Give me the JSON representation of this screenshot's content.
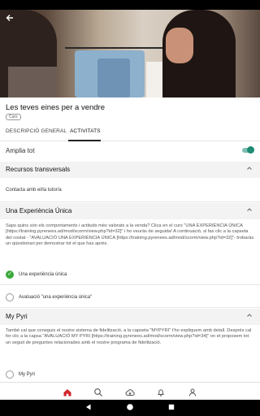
{
  "status_bar": {
    "time": "",
    "icons": ""
  },
  "hero": {
    "back_icon": "back-arrow-icon"
  },
  "course": {
    "title": "Les teves eines per a vendre",
    "chip": "Curs"
  },
  "tabs": [
    {
      "label": "DESCRIPCIÓ GENERAL"
    },
    {
      "label": "ACTIVITATS"
    }
  ],
  "expand_all": {
    "label": "Amplia tot",
    "enabled": true
  },
  "sections": {
    "recursos": {
      "title": "Recursos transversals",
      "item": "Contacta amb el/la tutor/a"
    },
    "experiencia": {
      "title": "Una Experiència Única",
      "description": "Saps quins són els comportaments i actituds més valorats a la venda? Clica en el curs \"UNA EXPERIÈNCIA ÚNICA [https://training.pyrenees.ad/mod/scorm/view.php?id=32]\" i ho veuràs de seguida! A continuació, si fas clic a la capseta del costat - \"AVALUACIÓ UNA EXPERIÈNCIA ÚNICA [https://training.pyrenees.ad/mod/scorm/view.php?id=32]\"- trobaràs un qüestionari per demostrar tot el que has après.",
      "activities": [
        {
          "label": "Una experiència única",
          "done": true
        },
        {
          "label": "Avaluació \"una experiència única\"",
          "done": false
        }
      ]
    },
    "mypyri": {
      "title": "My Pyri",
      "description": "També cal que coneguis el nostre sistema de fidelització, a la capseta \"MYPYRI\" t'ho expliquem amb detall. Després cal fer clic a la capsa \"AVALUACIÓ MY PYRI [https://training.pyrenees.ad/mod/scorm/view.php?id=34]\" on et proposem tot un seguit de preguntes relacionades amb el nostre programa de fidelització.",
      "activities": [
        {
          "label": "My Pyri",
          "done": false
        }
      ]
    }
  },
  "colors": {
    "accent": "#d1262c",
    "toggle": "#1e8a72",
    "done": "#3ba83b"
  },
  "bottom_nav": [
    "home-icon",
    "search-icon",
    "cloud-download-icon",
    "bell-icon",
    "user-icon"
  ],
  "system_nav": [
    "back-triangle-icon",
    "home-circle-icon",
    "recents-square-icon"
  ]
}
